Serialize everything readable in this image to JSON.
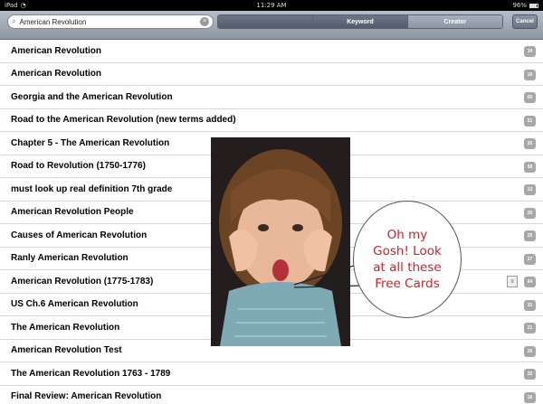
{
  "status_bar": {
    "device": "iPad",
    "time": "11:29 AM",
    "battery": "96%"
  },
  "toolbar": {
    "search_value": "American Revolution",
    "segments": [
      "",
      "Keyword",
      "Creator"
    ],
    "active_segment": "Keyword",
    "cancel_label": "Cancel"
  },
  "results": [
    {
      "title": "American Revolution",
      "count": "34"
    },
    {
      "title": "American Revolution",
      "count": "16"
    },
    {
      "title": "Georgia and the American Revolution",
      "count": "60"
    },
    {
      "title": "Road to the American Revolution (new terms added)",
      "count": "51"
    },
    {
      "title": "Chapter 5 - The American Revolution",
      "count": "25"
    },
    {
      "title": "Road to Revolution (1750-1776)",
      "count": "58"
    },
    {
      "title": "must look up real definition 7th grade",
      "count": "13"
    },
    {
      "title": "American Revolution People",
      "count": "20"
    },
    {
      "title": "Causes of American Revolution",
      "count": "25"
    },
    {
      "title": "Ranly American Revolution",
      "count": "27"
    },
    {
      "title": "American Revolution (1775-1783)",
      "count": "64"
    },
    {
      "title": "US Ch.6 American Revolution",
      "count": "31"
    },
    {
      "title": "The American Revolution",
      "count": "21"
    },
    {
      "title": "American Revolution Test",
      "count": "26"
    },
    {
      "title": "The American Revolution 1763 - 1789",
      "count": "32"
    },
    {
      "title": "Final Review: American Revolution",
      "count": "16"
    }
  ],
  "row_note_icon": "note-icon",
  "bubble": {
    "lines": [
      "Oh my",
      "Gosh! Look",
      "at all these",
      "Free Cards"
    ]
  },
  "colors": {
    "bubble_text": "#d0202a",
    "count_badge": "#a7a7a7"
  }
}
